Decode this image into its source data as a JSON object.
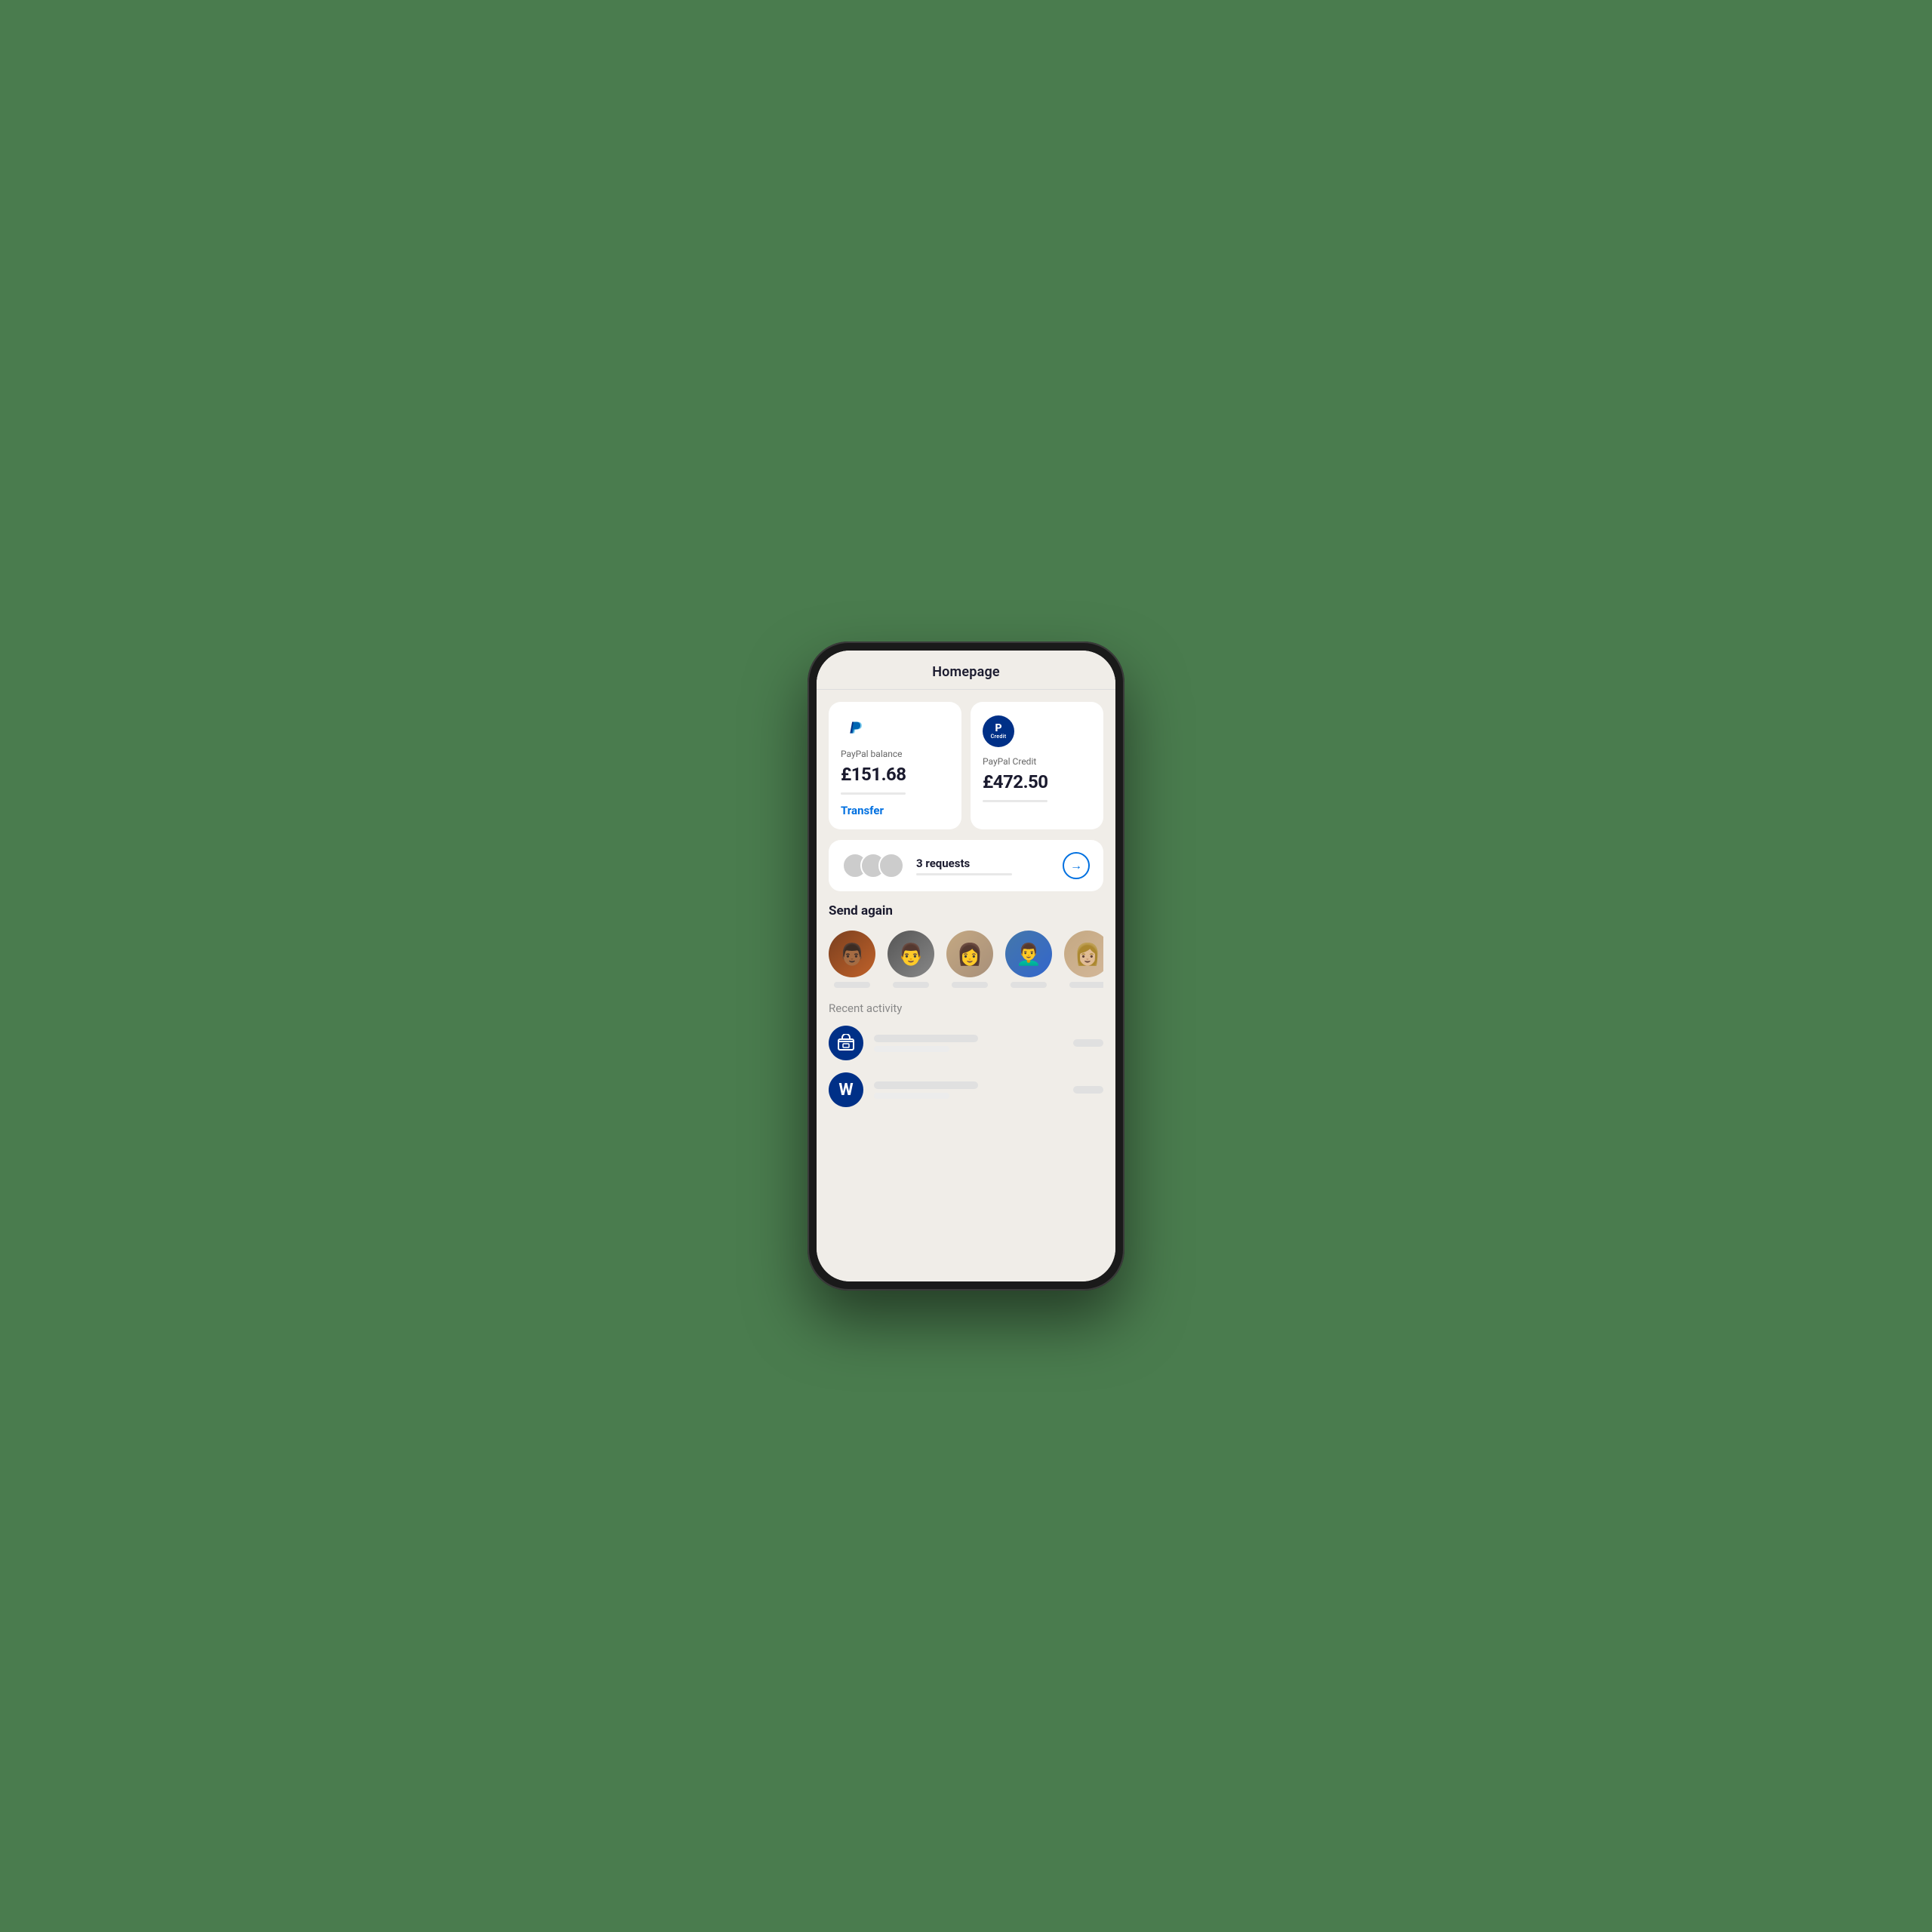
{
  "page": {
    "title": "Homepage",
    "background": "#4a7c59"
  },
  "balance_cards": {
    "paypal_balance": {
      "label": "PayPal balance",
      "amount": "£151.68",
      "transfer_label": "Transfer"
    },
    "paypal_credit": {
      "label": "PayPal Credit",
      "amount": "£472.50",
      "credit_text": "Credit"
    }
  },
  "requests": {
    "count_label": "3 requests",
    "count": 3,
    "arrow": "→"
  },
  "send_again": {
    "section_title": "Send again",
    "contacts": [
      {
        "id": 1,
        "color": "contact-1"
      },
      {
        "id": 2,
        "color": "contact-2"
      },
      {
        "id": 3,
        "color": "contact-3"
      },
      {
        "id": 4,
        "color": "contact-4"
      },
      {
        "id": 5,
        "color": "contact-5"
      }
    ]
  },
  "recent_activity": {
    "section_title": "Recent activity",
    "items": [
      {
        "id": 1,
        "icon_type": "shop",
        "icon_char": "🏪"
      },
      {
        "id": 2,
        "icon_type": "letter",
        "icon_char": "W"
      }
    ]
  }
}
